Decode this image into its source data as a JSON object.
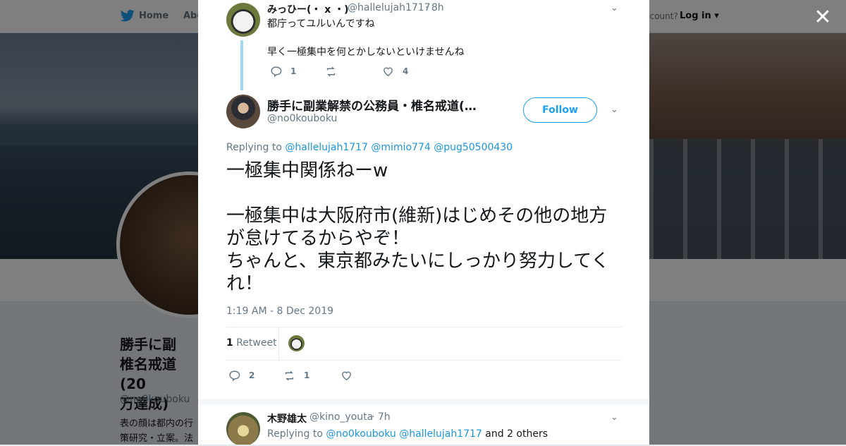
{
  "topbar": {
    "home": "Home",
    "about": "Abo",
    "have_account": "ccount?",
    "login": "Log in"
  },
  "profile": {
    "name": "勝手に副業解禁の公務員・椎名戒道(20万達成)",
    "name_lines": [
      "勝手に副",
      "椎名戒道(20",
      "万達成)"
    ],
    "handle": "@no0kouboku",
    "bio_lines": [
      "表の顔は都内の行",
      "策研究・立案。法"
    ]
  },
  "colors": {
    "link": "#1b95e0",
    "accent": "#1da1f2",
    "thread": "#a3d7f7"
  },
  "parent_tweet": {
    "name": "みっひー(・ x ・)",
    "handle": "@hallelujah1717",
    "time": "· 8h",
    "line1": "都庁ってユルいんですね",
    "line2": "早く一極集中を何とかしないといけませんね",
    "replies": "1",
    "retweets": "",
    "likes": "4",
    "avatar": "panda-avatar"
  },
  "main_tweet": {
    "name": "勝手に副業解禁の公務員・椎名戒道(…",
    "handle": "@no0kouboku",
    "follow_label": "Follow",
    "replying_label": "Replying to",
    "replying_to": [
      "@hallelujah1717",
      "@mimio774",
      "@pug50500430"
    ],
    "text_line1": "一極集中関係ねーw",
    "text_line2": "一極集中は大阪府市(維新)はじめその他の地方が怠けてるからやぞ！",
    "text_line3": "ちゃんと、東京都みたいにしっかり努力してくれ！",
    "timestamp": "1:19 AM - 8 Dec 2019",
    "retweet_count": "1",
    "retweet_label": "Retweet",
    "replies": "2",
    "retweets": "1",
    "likes": ""
  },
  "reply_tweet": {
    "name": "木野雄太",
    "handle": "@kino_youta",
    "time": "· 7h",
    "replying_label": "Replying to",
    "replying_to": [
      "@no0kouboku",
      "@hallelujah1717"
    ],
    "others": "and 2 others"
  }
}
